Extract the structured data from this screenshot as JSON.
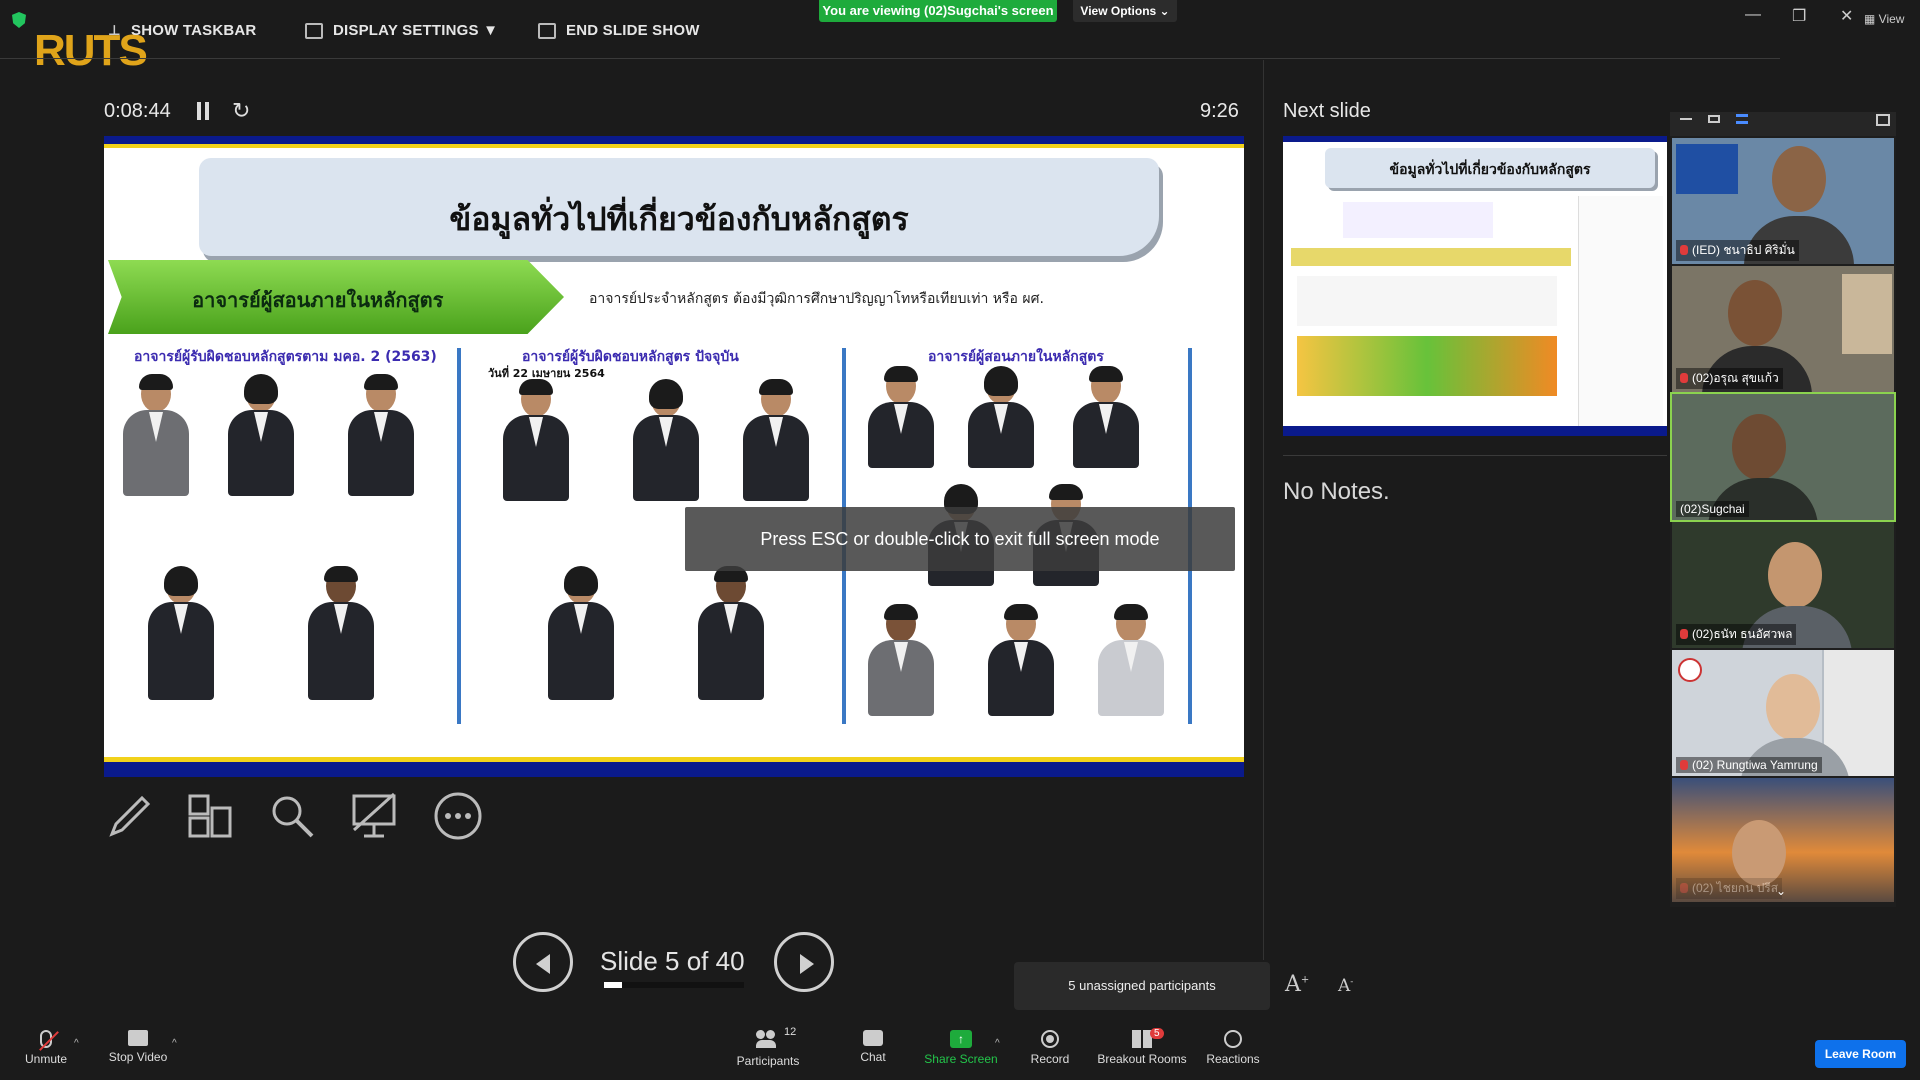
{
  "topbar": {
    "show_taskbar": "SHOW TASKBAR",
    "display_settings": "DISPLAY SETTINGS ▼",
    "end_show": "END SLIDE SHOW",
    "viewing_banner": "You are viewing (02)Sugchai's screen",
    "view_options": "View Options ⌄",
    "view_label": "View"
  },
  "logo": {
    "main": "RUT",
    "accent": "S"
  },
  "presenter": {
    "elapsed": "0:08:44",
    "clock": "9:26",
    "next_label": "Next slide",
    "notes": "No Notes."
  },
  "slide": {
    "title": "ข้อมูลทั่วไปที่เกี่ยวข้องกับหลักสูตร",
    "banner": "อาจารย์ผู้สอนภายในหลักสูตร",
    "requirement": "อาจารย์ประจำหลักสูตร ต้องมีวุฒิการศึกษาปริญญาโทหรือเทียบเท่า หรือ ผศ.",
    "col1": "อาจารย์ผู้รับผิดชอบหลักสูตรตาม มคอ. 2 (2563)",
    "col2": "อาจารย์ผู้รับผิดชอบหลักสูตร ปัจจุบัน",
    "col2_date": "วันที่ 22 เมษายน 2564",
    "col3": "อาจารย์ผู้สอนภายในหลักสูตร"
  },
  "next_slide": {
    "title": "ข้อมูลทั่วไปที่เกี่ยวข้องกับหลักสูตร"
  },
  "overlay": {
    "esc_msg": "Press ESC or double-click to exit full screen mode"
  },
  "nav": {
    "slide_count": "Slide 5 of 40",
    "current": 5,
    "total": 40
  },
  "participants": [
    {
      "name": "(IED) ชนาธิป ศิริมั่น",
      "muted": true
    },
    {
      "name": "(02)อรุณ สุขแก้ว",
      "muted": true
    },
    {
      "name": "(02)Sugchai",
      "muted": false
    },
    {
      "name": "(02)ธนัท ธนอัศวพล",
      "muted": true
    },
    {
      "name": "(02) Rungtiwa Yamrung",
      "muted": true
    },
    {
      "name": "(02) ไชยกน ปรีส",
      "muted": true
    }
  ],
  "unassigned": "5 unassigned participants",
  "bottombar": {
    "unmute": "Unmute",
    "stop_video": "Stop Video",
    "participants": "Participants",
    "participants_count": "12",
    "chat": "Chat",
    "share_screen": "Share Screen",
    "record": "Record",
    "breakout": "Breakout Rooms",
    "breakout_badge": "5",
    "reactions": "Reactions",
    "leave": "Leave Room"
  },
  "colors": {
    "banner_green": "#1eab3c",
    "leave_blue": "#0e71eb",
    "slide_navy": "#0a1a8c",
    "slide_yellow": "#f2d21b"
  }
}
